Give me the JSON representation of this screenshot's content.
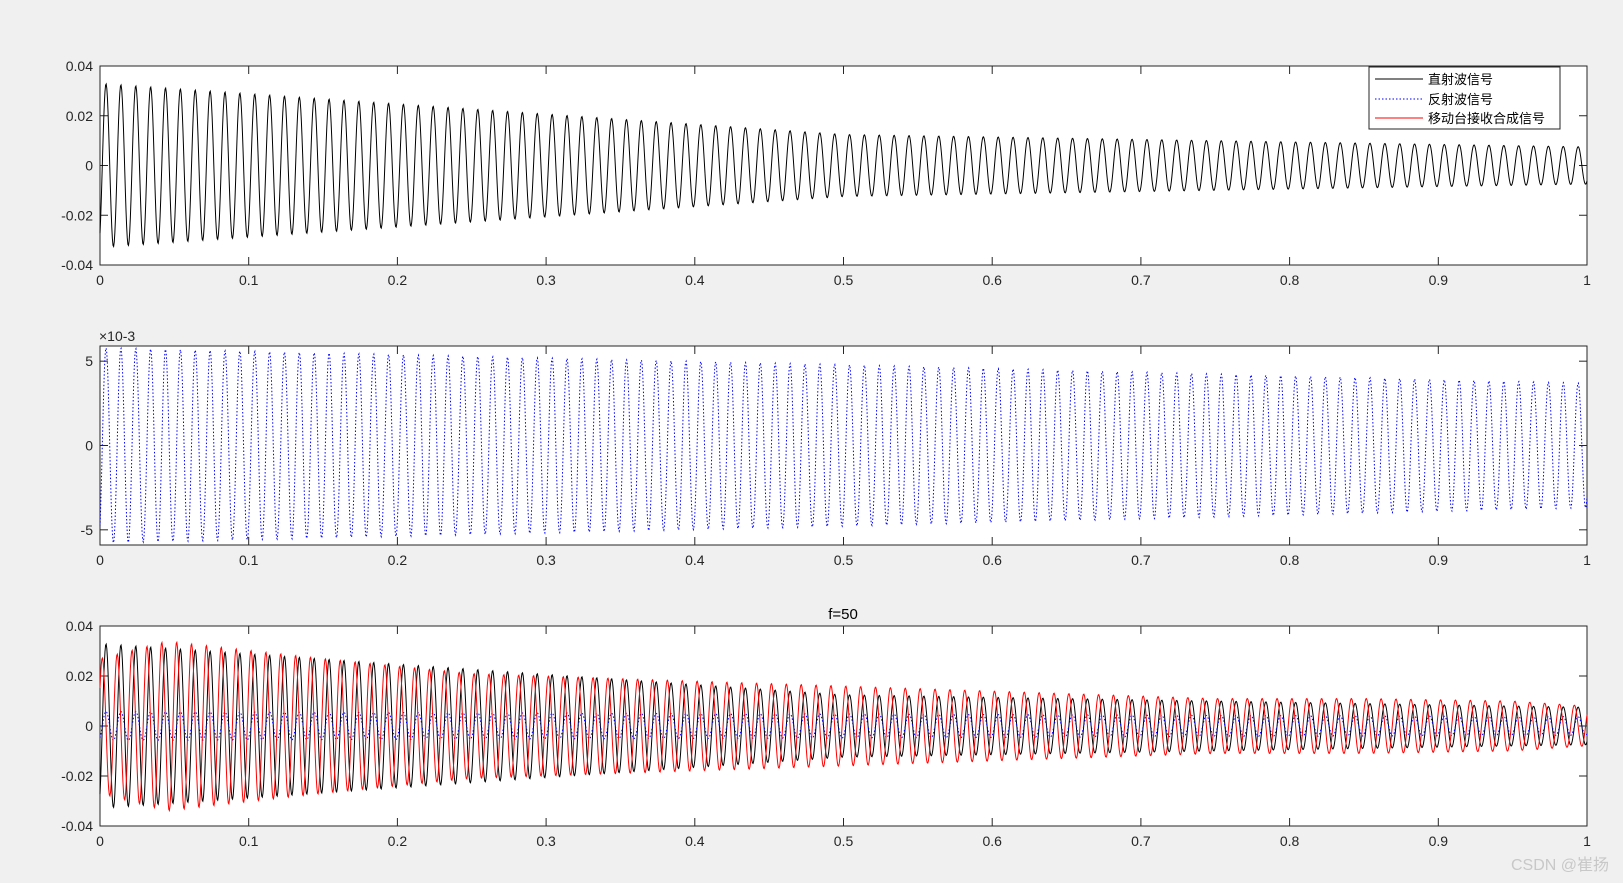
{
  "chart_data": [
    {
      "type": "line",
      "title": "",
      "xlim": [
        0,
        1
      ],
      "ylim": [
        -0.04,
        0.04
      ],
      "xticks": [
        "0",
        "0.1",
        "0.2",
        "0.3",
        "0.4",
        "0.5",
        "0.6",
        "0.7",
        "0.8",
        "0.9",
        "1"
      ],
      "yticks": [
        "-0.04",
        "-0.02",
        "0",
        "0.02",
        "0.04"
      ],
      "grid": false,
      "legend_position": "top-right",
      "legend": [
        "直射波信号",
        "反射波信号",
        "移动台接收合成信号"
      ],
      "series": [
        {
          "name": "直射波信号",
          "color": "#000000",
          "style": "solid",
          "cycles": 100,
          "envelope": {
            "x": [
              0,
              0.5,
              1
            ],
            "y": [
              0.033,
              0.0125,
              0.0075
            ]
          }
        }
      ]
    },
    {
      "type": "line",
      "title": "",
      "scale_label": "×10-3",
      "xlim": [
        0,
        1
      ],
      "ylim": [
        -5.9,
        5.9
      ],
      "xticks": [
        "0",
        "0.1",
        "0.2",
        "0.3",
        "0.4",
        "0.5",
        "0.6",
        "0.7",
        "0.8",
        "0.9",
        "1"
      ],
      "yticks": [
        "-5",
        "0",
        "5"
      ],
      "grid": false,
      "series": [
        {
          "name": "反射波信号",
          "color": "#0000ff",
          "style": "dotted",
          "cycles": 100,
          "envelope": {
            "x": [
              0,
              0.5,
              1
            ],
            "y": [
              5.8,
              4.8,
              3.7
            ]
          }
        }
      ]
    },
    {
      "type": "line",
      "title": "f=50",
      "xlim": [
        0,
        1
      ],
      "ylim": [
        -0.04,
        0.04
      ],
      "xticks": [
        "0",
        "0.1",
        "0.2",
        "0.3",
        "0.4",
        "0.5",
        "0.6",
        "0.7",
        "0.8",
        "0.9",
        "1"
      ],
      "yticks": [
        "-0.04",
        "-0.02",
        "0",
        "0.02",
        "0.04"
      ],
      "grid": false,
      "series": [
        {
          "name": "直射波信号",
          "color": "#000000",
          "style": "solid",
          "cycles": 100,
          "envelope": {
            "x": [
              0,
              0.5,
              1
            ],
            "y": [
              0.033,
              0.0125,
              0.0075
            ]
          }
        },
        {
          "name": "反射波信号",
          "color": "#0000ff",
          "style": "dotted",
          "cycles": 100,
          "envelope": {
            "x": [
              0,
              0.5,
              1
            ],
            "y": [
              0.0058,
              0.0048,
              0.0037
            ]
          }
        },
        {
          "name": "移动台接收合成信号",
          "color": "#ff0000",
          "style": "solid",
          "cycles": 100,
          "phase_offset": 0.25,
          "envelope": {
            "x": [
              0,
              0.045,
              0.15,
              0.25,
              0.35,
              0.45,
              0.55,
              0.65,
              0.75,
              0.85,
              0.95,
              1
            ],
            "y": [
              0.027,
              0.034,
              0.027,
              0.021,
              0.019,
              0.017,
              0.015,
              0.013,
              0.011,
              0.011,
              0.01,
              0.008
            ]
          }
        }
      ]
    }
  ],
  "watermark": "CSDN @崔扬"
}
